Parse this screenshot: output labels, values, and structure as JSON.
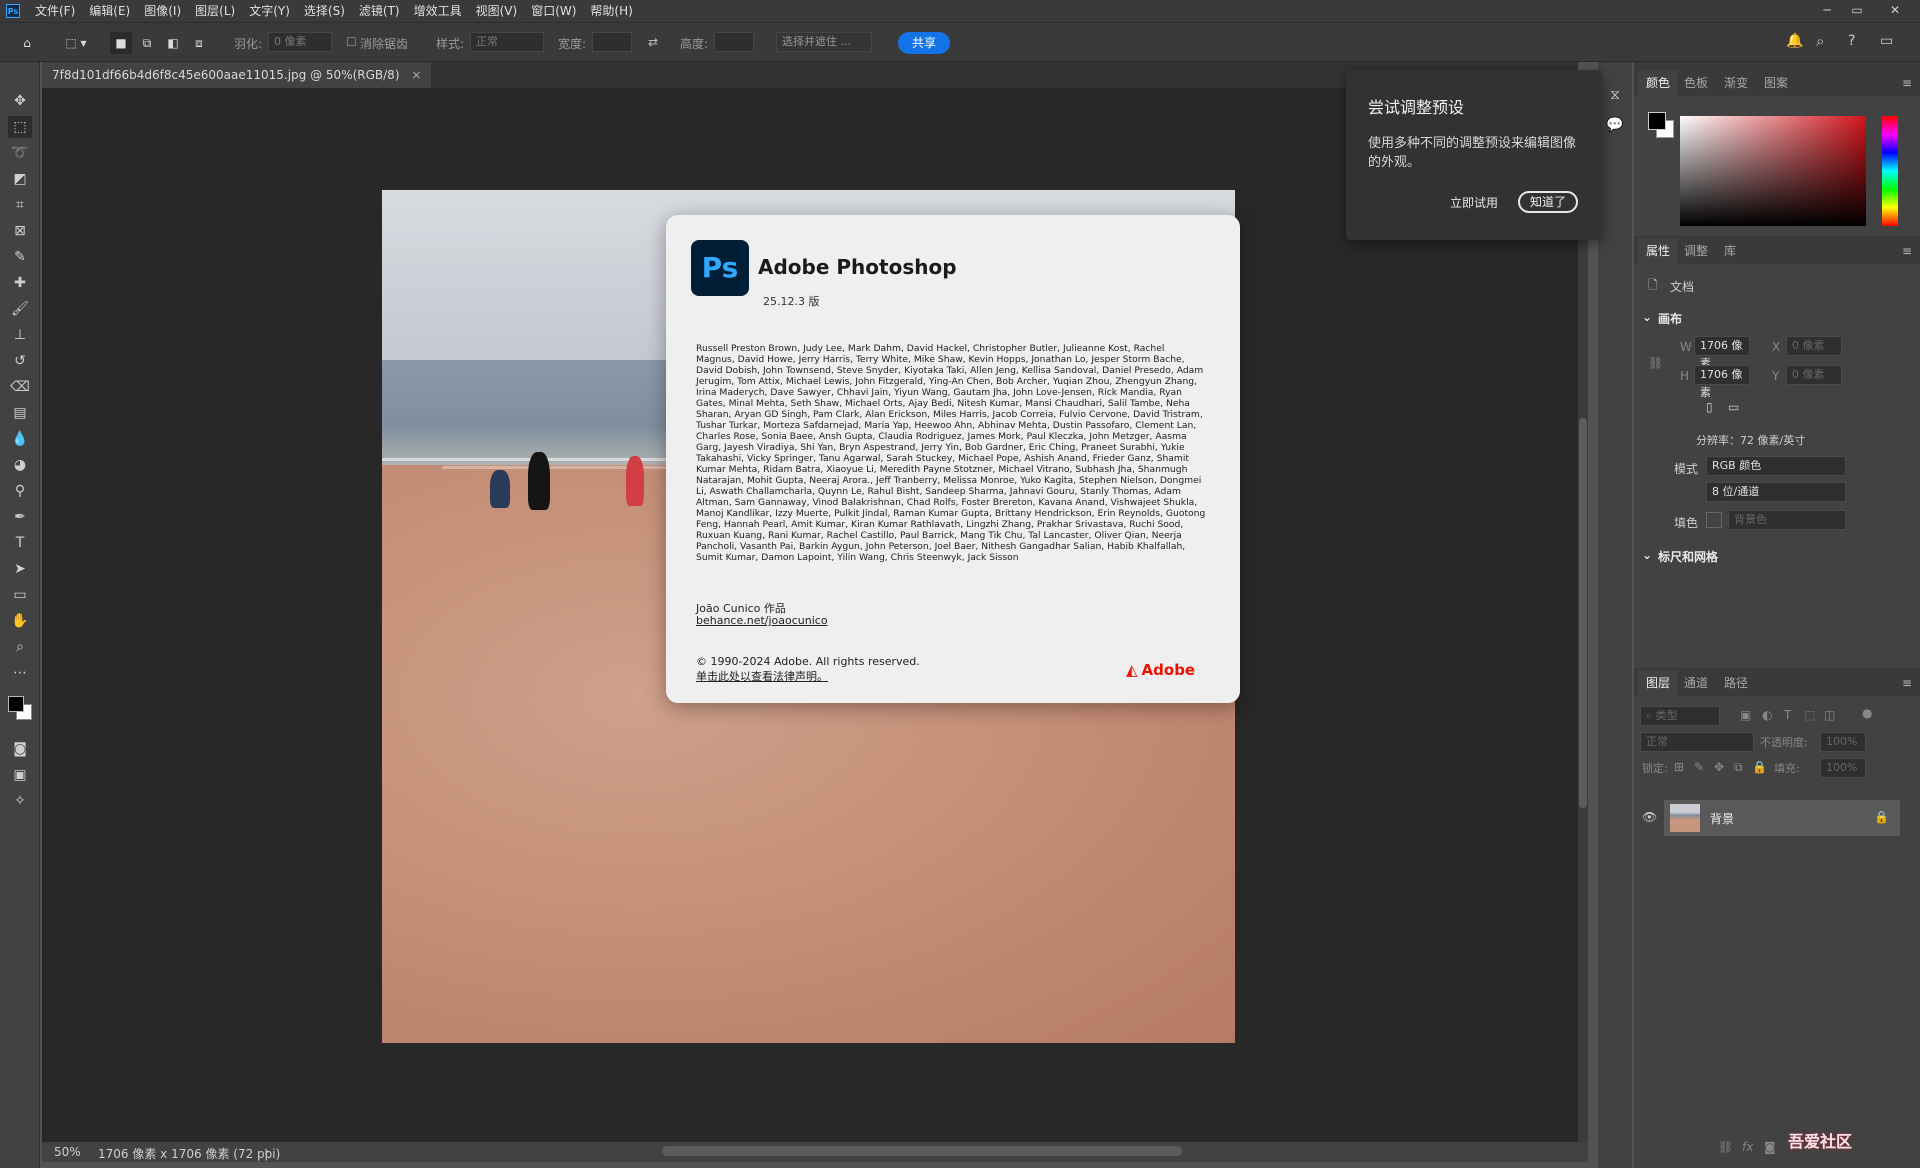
{
  "menubar": {
    "items": [
      "文件(F)",
      "编辑(E)",
      "图像(I)",
      "图层(L)",
      "文字(Y)",
      "选择(S)",
      "滤镜(T)",
      "增效工具",
      "视图(V)",
      "窗口(W)",
      "帮助(H)"
    ],
    "window_controls": [
      "─",
      "▭",
      "✕"
    ]
  },
  "options": {
    "feather_label": "羽化:",
    "feather_value": "0 像素",
    "antialias_label": "消除锯齿",
    "style_label": "样式:",
    "style_value": "正常",
    "width_label": "宽度:",
    "height_label": "高度:",
    "select_subject": "选择并遮住 ...",
    "share": "共享"
  },
  "document": {
    "tab": "7f8d101df66b4d6f8c45e600aae11015.jpg @ 50%(RGB/8)",
    "tab_close": "×"
  },
  "about": {
    "logo": "Ps",
    "title": "Adobe Photoshop",
    "version": "25.12.3 版",
    "credits": "Russell Preston Brown, Judy Lee, Mark Dahm, David Hackel, Christopher Butler, Julieanne Kost, Rachel Magnus, David Howe, Jerry Harris, Terry White, Mike Shaw, Kevin Hopps, Jonathan Lo, Jesper Storm Bache, David Dobish, John Townsend, Steve Snyder, Kiyotaka Taki, Allen Jeng, Kellisa Sandoval, Daniel Presedo, Adam Jerugim, Tom Attix, Michael Lewis, John Fitzgerald, Ying-An Chen, Bob Archer, Yuqian Zhou, Zhengyun Zhang, Irina Maderych, Dave Sawyer, Chhavi Jain, Yiyun Wang, Gautam Jha, John Love-Jensen, Rick Mandia, Ryan Gates, Minal Mehta, Seth Shaw, Michael Orts, Ajay Bedi, Nitesh Kumar, Mansi Chaudhari, Salil Tambe, Neha Sharan, Aryan GD Singh, Pam Clark, Alan Erickson, Miles Harris, Jacob Correia, Fulvio Cervone, David Tristram, Tushar Turkar, Morteza Safdarnejad, Maria Yap, Heewoo Ahn, Abhinav Mehta, Dustin Passofaro, Clement Lan, Charles Rose, Sonia Baee, Ansh Gupta, Claudia Rodriguez, James Mork, Paul Kleczka, John Metzger, Aasma Garg, Jayesh Viradiya, Shi Yan, Bryn Aspestrand, Jerry Yin, Bob Gardner, Eric Ching, Praneet Surabhi, Yukie Takahashi, Vicky Springer, Tanu Agarwal, Sarah Stuckey, Michael Pope, Ashish Anand, Frieder Ganz, Shamit Kumar Mehta, Ridam Batra, Xiaoyue Li, Meredith Payne Stotzner, Michael Vitrano, Subhash Jha, Shanmugh Natarajan, Mohit Gupta, Neeraj Arora., Jeff Tranberry, Melissa Monroe, Yuko Kagita, Stephen Nielson, Dongmei Li, Aswath Challamcharla, Quynn Le, Rahul Bisht, Sandeep Sharma, Jahnavi Gouru, Stanly Thomas, Adam Altman, Sam Gannaway, Vinod Balakrishnan, Chad Rolfs, Foster Brereton, Kavana Anand, Vishwajeet Shukla, Manoj Kandlikar, Izzy Muerte, Pulkit Jindal, Raman Kumar Gupta, Brittany Hendrickson, Erin Reynolds, Guotong Feng, Hannah Pearl, Amit Kumar, Kiran Kumar Rathlavath, Lingzhi Zhang, Prakhar Srivastava, Ruchi Sood, Ruxuan Kuang, Rani Kumar, Rachel Castillo, Paul Barrick, Mang Tik Chu, Tal Lancaster, Oliver Qian, Neerja Pancholi, Vasanth Pai, Barkin Aygun, John Peterson, Joel Baer, Nithesh Gangadhar Salian, Habib Khalfallah, Sumit Kumar, Damon Lapoint, Yilin Wang, Chris Steenwyk, Jack Sisson",
    "author": "João Cunico 作品",
    "author_link": "behance.net/joaocunico",
    "copyright": "© 1990-2024 Adobe. All rights reserved.",
    "legal_link": "单击此处以查看法律声明。",
    "adobe_label": "Adobe"
  },
  "status": {
    "zoom": "50%",
    "doc_info": "1706 像素 x 1706 像素 (72 ppi)",
    "arrow": "›"
  },
  "popup": {
    "title": "尝试调整预设",
    "text": "使用多种不同的调整预设来编辑图像的外观。",
    "try_label": "立即试用",
    "ok_label": "知道了"
  },
  "color_panel": {
    "tabs": [
      "颜色",
      "色板",
      "渐变",
      "图案"
    ],
    "foreground": "#000000",
    "background": "#ffffff"
  },
  "properties_panel": {
    "tabs": [
      "属性",
      "调整",
      "库"
    ],
    "doc_label": "文档",
    "canvas_section": "画布",
    "w_label": "W",
    "w_value": "1706 像素",
    "x_label": "X",
    "x_placeholder": "0 像素",
    "h_label": "H",
    "h_value": "1706 像素",
    "y_label": "Y",
    "y_placeholder": "0 像素",
    "resolution": "分辨率：72 像素/英寸",
    "mode_label": "模式",
    "mode_value": "RGB 颜色",
    "depth_value": "8 位/通道",
    "fill_label": "填色",
    "fill_value": "背景色",
    "rulers_section": "标尺和网格"
  },
  "layers_panel": {
    "tabs": [
      "图层",
      "通道",
      "路径"
    ],
    "search_placeholder": "类型",
    "blend_mode": "正常",
    "opacity_label": "不透明度:",
    "opacity_value": "100%",
    "lock_label": "锁定:",
    "fill_label": "填充:",
    "fill_value": "100%",
    "layer_name": "背景"
  },
  "watermark": "吾爱社区"
}
